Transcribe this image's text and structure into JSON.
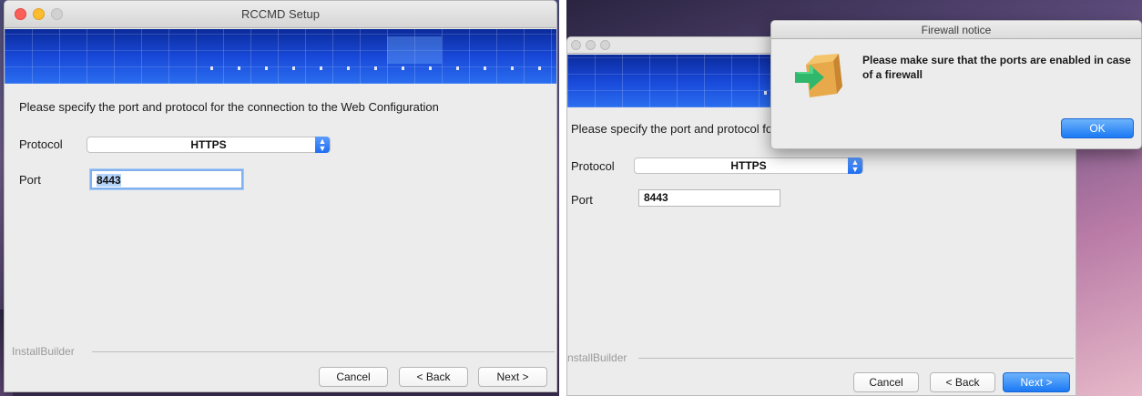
{
  "left_window": {
    "title": "RCCMD Setup",
    "instruction": "Please specify the port and protocol for the connection to the Web Configuration",
    "protocol_label": "Protocol",
    "protocol_value": "HTTPS",
    "port_label": "Port",
    "port_value": "8443",
    "installbuilder": "InstallBuilder",
    "cancel_label": "Cancel",
    "back_label": "< Back",
    "next_label": "Next >"
  },
  "right_window": {
    "instruction": "Please specify the port and protocol for",
    "protocol_label": "Protocol",
    "protocol_value": "HTTPS",
    "port_label": "Port",
    "port_value": "8443",
    "installbuilder": "nstallBuilder",
    "cancel_label": "Cancel",
    "back_label": "< Back",
    "next_label": "Next >"
  },
  "dialog": {
    "title": "Firewall notice",
    "message": "Please make sure that the ports are enabled in case of a firewall",
    "ok_label": "OK",
    "icon": "box-arrow-icon"
  },
  "colors": {
    "accent": "#1b79f5",
    "banner": "#1848d8",
    "close": "#fc5f57",
    "minimize": "#fdbc2e"
  }
}
